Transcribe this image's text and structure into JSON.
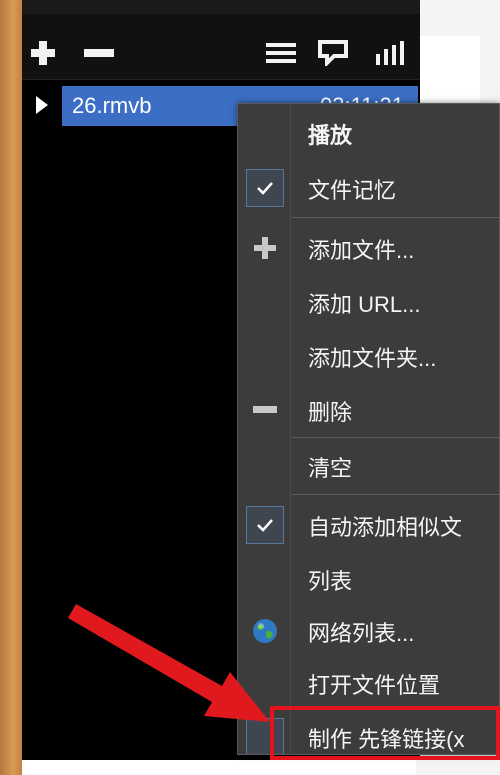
{
  "toolbar": {
    "icons": [
      "plus-icon",
      "minus-icon",
      "list-icon",
      "comment-icon",
      "bars-icon"
    ]
  },
  "playlist": {
    "file_name": "26.rmvb",
    "file_meta": "03:11:21"
  },
  "context_menu": {
    "items": [
      {
        "label": "播放",
        "bold": true
      },
      {
        "label": "文件记忆",
        "checked": true
      },
      {
        "label": "添加文件...",
        "icon": "plus-icon"
      },
      {
        "label": "添加 URL..."
      },
      {
        "label": "添加文件夹..."
      },
      {
        "label": "删除",
        "icon": "minus-icon"
      },
      {
        "label": "清空"
      },
      {
        "label": "自动添加相似文",
        "checked": true
      },
      {
        "label": "列表"
      },
      {
        "label": "网络列表...",
        "icon": "globe-icon"
      },
      {
        "label": "打开文件位置"
      },
      {
        "label": "制作 先锋链接(x"
      }
    ]
  },
  "colors": {
    "selection": "#3b6ec4",
    "menu_bg": "#3c3c3c",
    "highlight_frame": "#e5141c",
    "arrow": "#e0191f"
  }
}
